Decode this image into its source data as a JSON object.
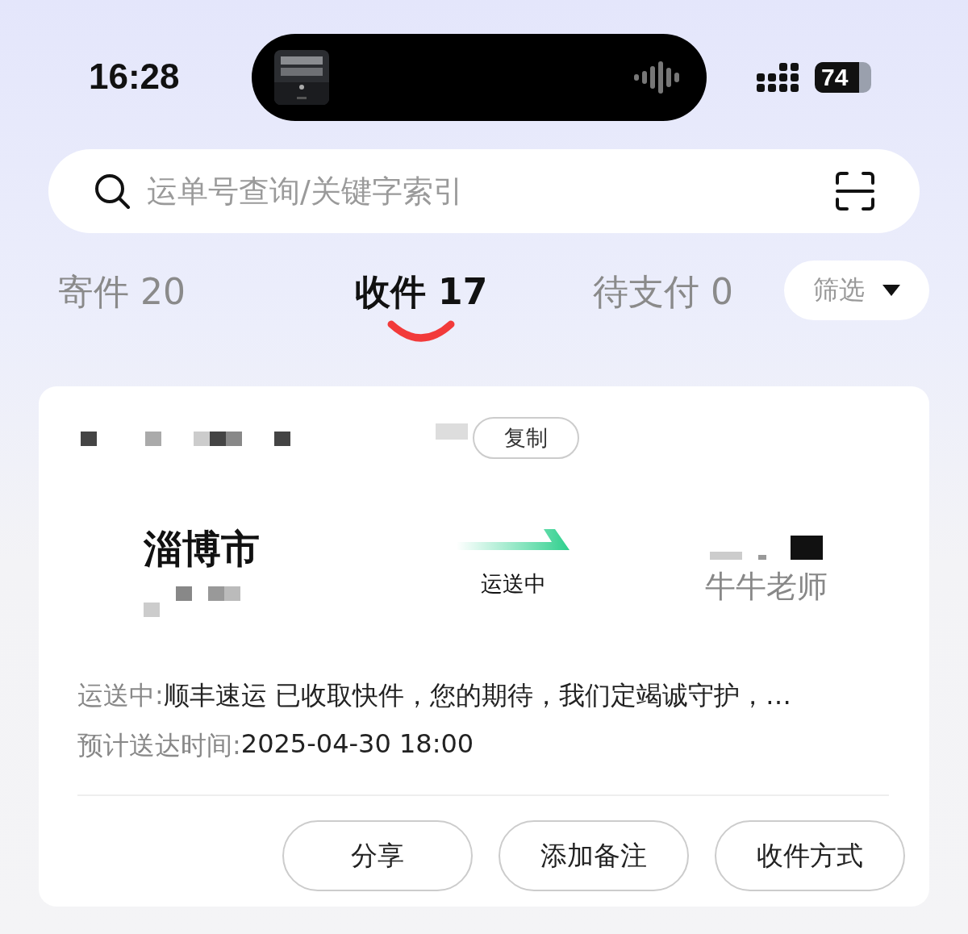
{
  "status_bar": {
    "time": "16:28",
    "battery": "74"
  },
  "search": {
    "placeholder": "运单号查询/关键字索引"
  },
  "tabs": [
    {
      "label": "寄件 20",
      "selected": false
    },
    {
      "label": "收件 17",
      "selected": true
    },
    {
      "label": "待支付 0",
      "selected": false
    }
  ],
  "filter": {
    "label": "筛选"
  },
  "shipment": {
    "copy_button": "复制",
    "origin": "淄博市",
    "status": "运送中",
    "recipient": "牛牛老师",
    "details": [
      {
        "label": "运送中:",
        "value": "顺丰速运 已收取快件，您的期待，我们定竭诚守护，…"
      },
      {
        "label": "预计送达时间:",
        "value": "2025-04-30 18:00"
      }
    ],
    "actions": [
      "分享",
      "添加备注",
      "收件方式"
    ]
  }
}
